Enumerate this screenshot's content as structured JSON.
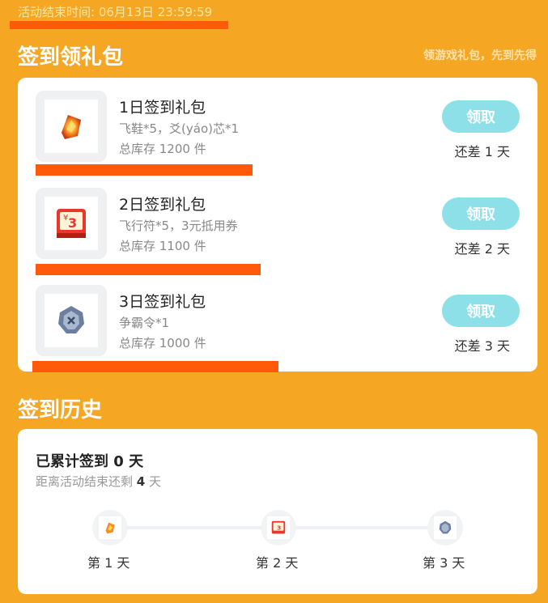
{
  "header": {
    "end_time": "活动结束时间: 06月13日 23:59:59"
  },
  "signin_section": {
    "title": "签到领礼包",
    "hint": "领游戏礼包，先到先得"
  },
  "packages": [
    {
      "title": "1日签到礼包",
      "desc": "飞鞋*5，爻(yáo)芯*1",
      "stock": "总库存 1200 件",
      "button": "领取",
      "remain": "还差 1 天",
      "icon": "fire-gem-icon"
    },
    {
      "title": "2日签到礼包",
      "desc": "飞行符*5，3元抵用券",
      "stock": "总库存 1100 件",
      "button": "领取",
      "remain": "还差 2 天",
      "icon": "coupon-icon"
    },
    {
      "title": "3日签到礼包",
      "desc": "争霸令*1",
      "stock": "总库存 1000 件",
      "button": "领取",
      "remain": "还差 3 天",
      "icon": "emblem-icon"
    }
  ],
  "history_section": {
    "title": "签到历史",
    "total_prefix": "已累计签到",
    "total_value": "0",
    "total_suffix": "天",
    "left_prefix": "距离活动结束还剩",
    "left_value": "4",
    "left_suffix": "天",
    "days": [
      "第 1 天",
      "第 2 天",
      "第 3 天"
    ]
  },
  "colors": {
    "background": "#f5a623",
    "highlight_bar": "#ff5a0a",
    "button": "#8ee0e8"
  }
}
